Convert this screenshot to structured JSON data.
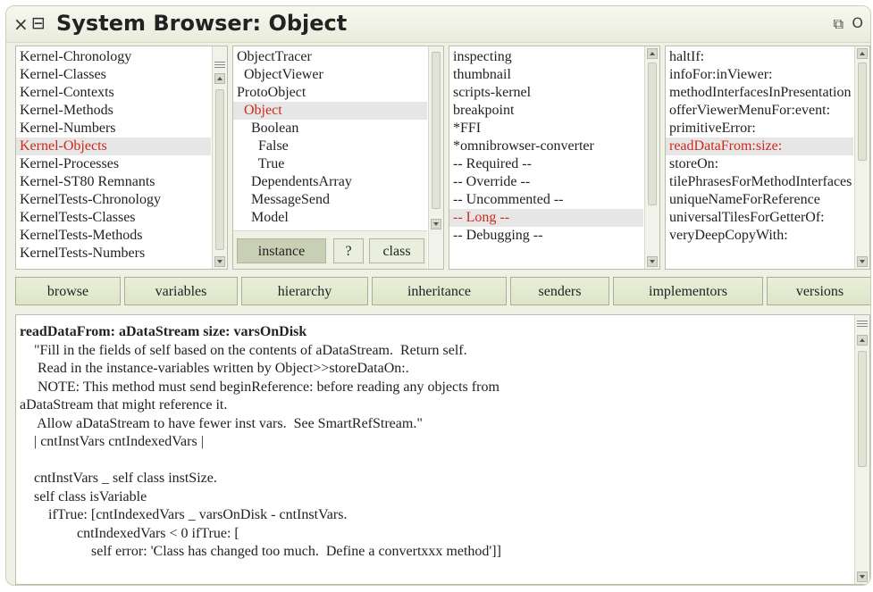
{
  "window": {
    "close_icon": "×",
    "menu_icon": "⊟",
    "title": "System Browser: Object",
    "collapse_icon": "⧉",
    "expand_icon": "O"
  },
  "packages": {
    "items": [
      {
        "label": "Kernel-Chronology"
      },
      {
        "label": "Kernel-Classes"
      },
      {
        "label": "Kernel-Contexts"
      },
      {
        "label": "Kernel-Methods"
      },
      {
        "label": "Kernel-Numbers"
      },
      {
        "label": "Kernel-Objects",
        "selected": true
      },
      {
        "label": "Kernel-Processes"
      },
      {
        "label": "Kernel-ST80 Remnants"
      },
      {
        "label": "KernelTests-Chronology"
      },
      {
        "label": "KernelTests-Classes"
      },
      {
        "label": "KernelTests-Methods"
      },
      {
        "label": "KernelTests-Numbers"
      }
    ]
  },
  "classes": {
    "items": [
      {
        "label": "ObjectTracer"
      },
      {
        "label": "  ObjectViewer"
      },
      {
        "label": "ProtoObject"
      },
      {
        "label": "  Object",
        "selected": true
      },
      {
        "label": "    Boolean"
      },
      {
        "label": "      False"
      },
      {
        "label": "      True"
      },
      {
        "label": "    DependentsArray"
      },
      {
        "label": "    MessageSend"
      },
      {
        "label": "    Model"
      }
    ],
    "buttons": {
      "instance": "instance",
      "help": "?",
      "class": "class"
    }
  },
  "protocols": {
    "items": [
      {
        "label": "inspecting"
      },
      {
        "label": "thumbnail"
      },
      {
        "label": "scripts-kernel"
      },
      {
        "label": "breakpoint"
      },
      {
        "label": "*FFI"
      },
      {
        "label": "*omnibrowser-converter"
      },
      {
        "label": "-- Required --"
      },
      {
        "label": "-- Override --"
      },
      {
        "label": "-- Uncommented --"
      },
      {
        "label": "-- Long --",
        "selected": true
      },
      {
        "label": "-- Debugging --"
      }
    ]
  },
  "methods": {
    "items": [
      {
        "label": "haltIf:"
      },
      {
        "label": "infoFor:inViewer:"
      },
      {
        "label": "methodInterfacesInPresentation"
      },
      {
        "label": "offerViewerMenuFor:event:"
      },
      {
        "label": "primitiveError:"
      },
      {
        "label": "readDataFrom:size:",
        "selected": true
      },
      {
        "label": "storeOn:"
      },
      {
        "label": "tilePhrasesForMethodInterfaces"
      },
      {
        "label": "uniqueNameForReference"
      },
      {
        "label": "universalTilesForGetterOf:"
      },
      {
        "label": "veryDeepCopyWith:"
      }
    ]
  },
  "toolbar": {
    "browse": "browse",
    "variables": "variables",
    "hierarchy": "hierarchy",
    "inheritance": "inheritance",
    "senders": "senders",
    "implementors": "implementors",
    "versions": "versions"
  },
  "code": {
    "lines": [
      "readDataFrom: aDataStream size: varsOnDisk",
      "    \"Fill in the fields of self based on the contents of aDataStream.  Return self.",
      "     Read in the instance-variables written by Object>>storeDataOn:.",
      "     NOTE: This method must send beginReference: before reading any objects from",
      "aDataStream that might reference it.",
      "     Allow aDataStream to have fewer inst vars.  See SmartRefStream.\"",
      "    | cntInstVars cntIndexedVars |",
      "",
      "    cntInstVars _ self class instSize.",
      "    self class isVariable",
      "        ifTrue: [cntIndexedVars _ varsOnDisk - cntInstVars.",
      "                cntIndexedVars < 0 ifTrue: [",
      "                    self error: 'Class has changed too much.  Define a convertxxx method']]"
    ]
  },
  "colors": {
    "selection_text": "#cc2a1c",
    "selection_bg": "#e6e6e6",
    "window_bg": "#eef1e4"
  }
}
